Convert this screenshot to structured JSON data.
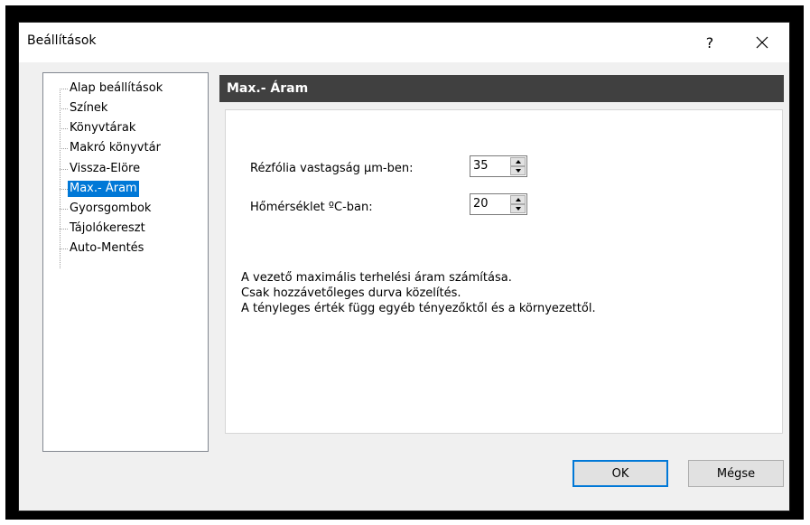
{
  "window": {
    "title": "Beállítások",
    "help_label": "?"
  },
  "tree": {
    "items": [
      {
        "label": "Alap beállítások"
      },
      {
        "label": "Színek"
      },
      {
        "label": "Könyvtárak"
      },
      {
        "label": "Makró könyvtár"
      },
      {
        "label": "Vissza-Elöre"
      },
      {
        "label": "Max.- Áram"
      },
      {
        "label": "Gyorsgombok"
      },
      {
        "label": "Tájolókereszt"
      },
      {
        "label": "Auto-Mentés"
      }
    ],
    "selected": "Max.- Áram"
  },
  "panel": {
    "title": "Max.- Áram",
    "fields": [
      {
        "label": "Rézfólia vastagság µm-ben:",
        "value": "35"
      },
      {
        "label": "Hőmérséklet ºC-ban:",
        "value": "20"
      }
    ],
    "description": [
      "A vezető maximális terhelési áram számítása.",
      "Csak hozzávetőleges durva közelítés.",
      "A tényleges érték függ egyéb tényezőktől és a környezettől."
    ]
  },
  "buttons": {
    "ok": "OK",
    "cancel": "Mégse"
  },
  "colors": {
    "header_bg": "#404040",
    "selection": "#0078d7"
  }
}
